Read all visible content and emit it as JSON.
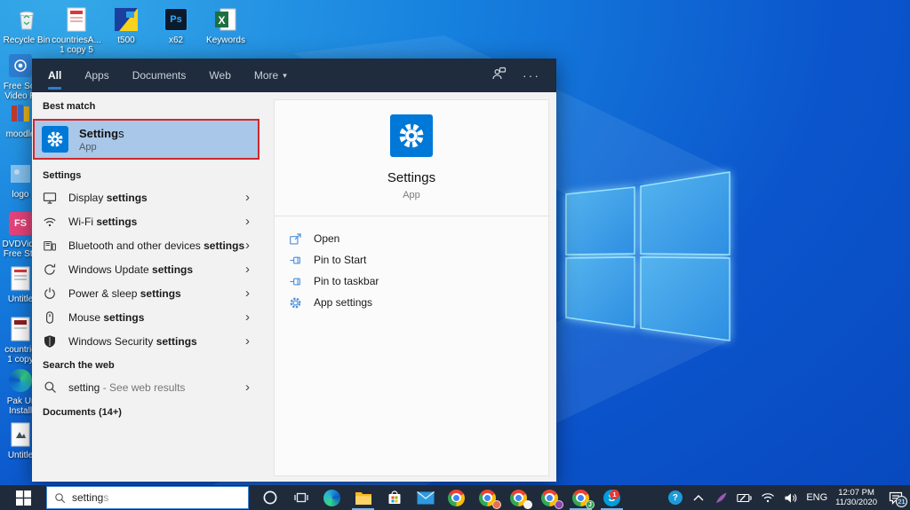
{
  "colors": {
    "accent": "#0078d7",
    "annotation_red": "#d0282e",
    "best_match_bg": "#a9c7e8",
    "panel_header_bg": "#1e2c3d",
    "taskbar_bg": "#1f2b3b"
  },
  "glyphs": {
    "chevron": "›",
    "caret": "▾",
    "ellipsis": "···"
  },
  "desktop": {
    "top_icons": [
      {
        "line1": "Recycle Bin",
        "line2": ""
      },
      {
        "line1": "countriesA...",
        "line2": "1 copy 5"
      },
      {
        "line1": "t500",
        "line2": ""
      },
      {
        "line1": "x62",
        "line2": ""
      },
      {
        "line1": "Keywords",
        "line2": ""
      }
    ],
    "left_icons": [
      {
        "line1": "Free Scr",
        "line2": "Video R"
      },
      {
        "line1": "moodle",
        "line2": ""
      },
      {
        "line1": "logo",
        "line2": ""
      },
      {
        "line1": "DVDVide",
        "line2": "Free Stu"
      },
      {
        "line1": "Untitle",
        "line2": ""
      },
      {
        "line1": "countrie",
        "line2": "1 copy"
      },
      {
        "line1": "Pak Ur",
        "line2": "Install"
      },
      {
        "line1": "Untitle",
        "line2": ""
      }
    ]
  },
  "search_panel": {
    "tabs": [
      {
        "label": "All"
      },
      {
        "label": "Apps"
      },
      {
        "label": "Documents"
      },
      {
        "label": "Web"
      },
      {
        "label": "More"
      }
    ],
    "best_match": {
      "header": "Best match",
      "title_bold": "Setting",
      "title_rest": "s",
      "subtitle": "App"
    },
    "settings_section": {
      "header": "Settings",
      "items": [
        {
          "icon": "display-icon",
          "prefix": "Display ",
          "bold": "settings"
        },
        {
          "icon": "wifi-icon",
          "prefix": "Wi-Fi ",
          "bold": "settings"
        },
        {
          "icon": "bluetooth-devices-icon",
          "prefix": "Bluetooth and other devices ",
          "bold": "settings"
        },
        {
          "icon": "windows-update-icon",
          "prefix": "Windows Update ",
          "bold": "settings"
        },
        {
          "icon": "power-sleep-icon",
          "prefix": "Power & sleep ",
          "bold": "settings"
        },
        {
          "icon": "mouse-icon",
          "prefix": "Mouse ",
          "bold": "settings"
        },
        {
          "icon": "windows-security-icon",
          "prefix": "Windows Security ",
          "bold": "settings"
        }
      ]
    },
    "web_section": {
      "header": "Search the web",
      "query": "setting",
      "suffix": "- See web results"
    },
    "documents_header": "Documents (14+)",
    "detail": {
      "app_name": "Settings",
      "app_type": "App",
      "actions": [
        {
          "icon": "open-icon",
          "label": "Open"
        },
        {
          "icon": "pin-icon",
          "label": "Pin to Start"
        },
        {
          "icon": "pin-icon",
          "label": "Pin to taskbar"
        },
        {
          "icon": "gear-icon",
          "label": "App settings"
        }
      ]
    }
  },
  "taskbar": {
    "search": {
      "typed": "setting",
      "suggestion": "s"
    },
    "skype_badge": "1",
    "chrome_profile_badge": "J",
    "tray": {
      "language": "ENG",
      "time": "12:07 PM",
      "date": "11/30/2020",
      "notification_count": "21"
    }
  }
}
